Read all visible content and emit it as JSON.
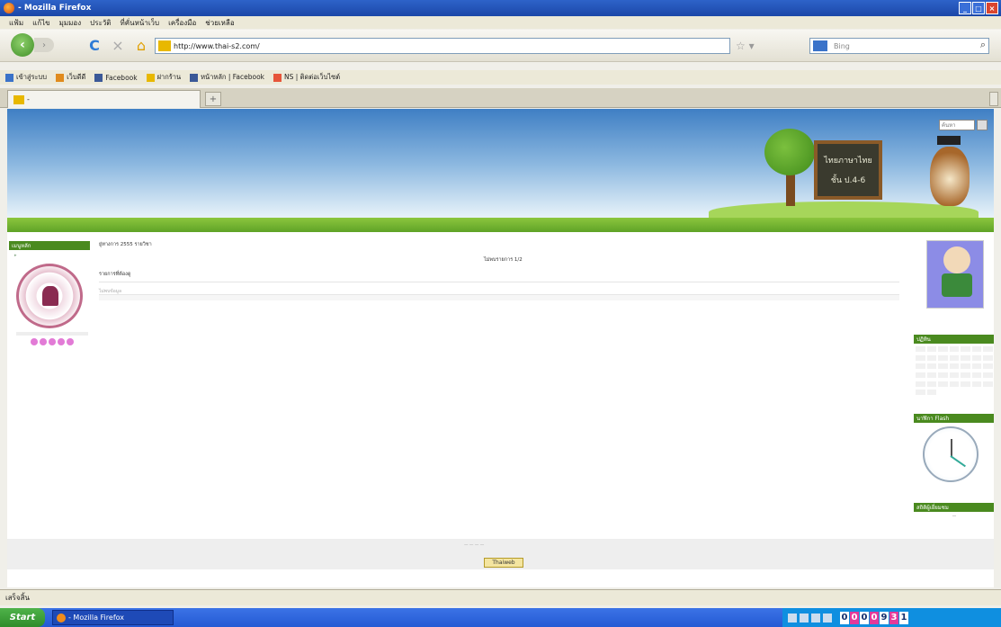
{
  "window": {
    "title": "- Mozilla Firefox"
  },
  "menu": [
    "แฟ้ม",
    "แก้ไข",
    "มุมมอง",
    "ประวัติ",
    "ที่คั่นหน้าเว็บ",
    "เครื่องมือ",
    "ช่วยเหลือ"
  ],
  "nav": {
    "url": "http://www.thai-s2.com/",
    "search_placeholder": "Bing"
  },
  "bookmarks": [
    {
      "label": "เข้าสู่ระบบ",
      "color": "#3b73c9"
    },
    {
      "label": "เว็บดีดี",
      "color": "#e08a1c"
    },
    {
      "label": "Facebook",
      "color": "#3b5998"
    },
    {
      "label": "ฝากร้าน",
      "color": "#e8b800"
    },
    {
      "label": "หน้าหลัก | Facebook",
      "color": "#3b5998"
    },
    {
      "label": "NS | ติดต่อเว็บไซต์",
      "color": "#e6553a"
    }
  ],
  "tab": {
    "label": "-"
  },
  "banner": {
    "board_line1": "ไทยภาษาไทย",
    "board_line2": "ชั้น ป.4-6",
    "search_placeholder": "ค้นหา"
  },
  "left_sidebar": {
    "header": "เมนูหลัก"
  },
  "main": {
    "line1": "ยู่ทางการ 2555 รายวิชา",
    "line2": "ไม่พบรายการ 1/2",
    "line3": "รายการที่ต้องดู",
    "line4": "ไม่พบข้อมูล"
  },
  "right_sidebar": {
    "calendar_header": "ปฏิทิน",
    "clock_header": "นาฬิกา Flash",
    "counter_header": "สถิติผู้เยี่ยมชม"
  },
  "footer": {
    "badge": "Thaiweb"
  },
  "status": {
    "text": "เสร็จสิ้น"
  },
  "taskbar": {
    "start": "Start",
    "task": "- Mozilla Firefox",
    "clock_digits": [
      "0",
      "0",
      "0",
      "0",
      "9",
      "3",
      "1"
    ]
  }
}
